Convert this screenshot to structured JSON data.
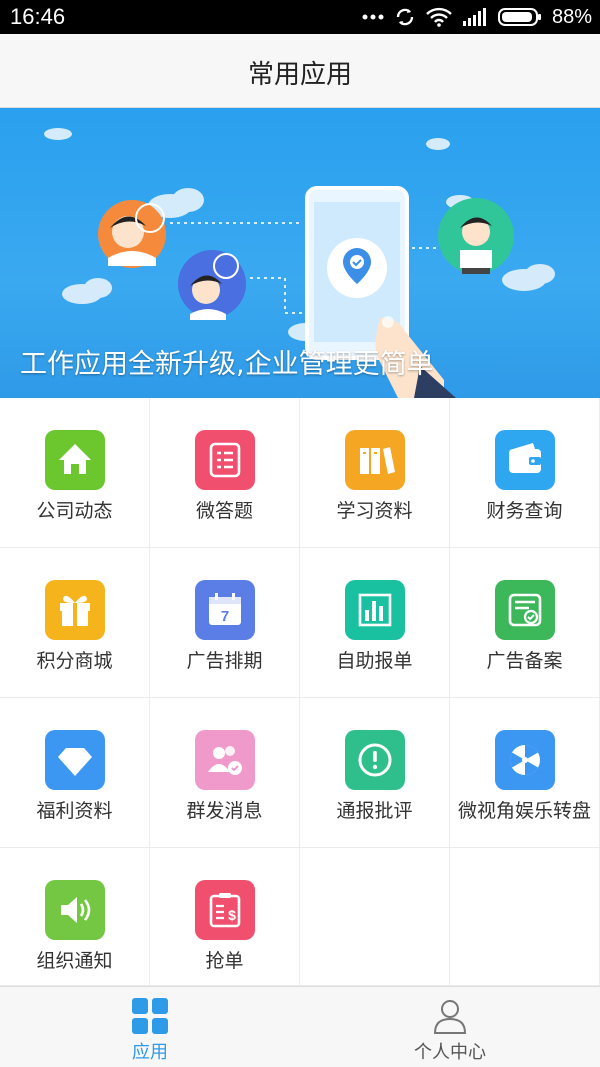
{
  "status_bar": {
    "time": "16:46",
    "battery": "88%"
  },
  "header": {
    "title": "常用应用"
  },
  "banner": {
    "caption": "工作应用全新升级,企业管理更简单"
  },
  "apps": [
    {
      "label": "公司动态",
      "icon": "home-icon",
      "color": "#6cc72e"
    },
    {
      "label": "微答题",
      "icon": "document-list-icon",
      "color": "#f0506e"
    },
    {
      "label": "学习资料",
      "icon": "books-icon",
      "color": "#f5a623"
    },
    {
      "label": "财务查询",
      "icon": "wallet-icon",
      "color": "#2fa6f0"
    },
    {
      "label": "积分商城",
      "icon": "gift-icon",
      "color": "#f5b41b"
    },
    {
      "label": "广告排期",
      "icon": "calendar-icon",
      "color": "#5b7ee6"
    },
    {
      "label": "自助报单",
      "icon": "bar-chart-icon",
      "color": "#19c1a0"
    },
    {
      "label": "广告备案",
      "icon": "certificate-icon",
      "color": "#3cb85a"
    },
    {
      "label": "福利资料",
      "icon": "diamond-icon",
      "color": "#3b97f2"
    },
    {
      "label": "群发消息",
      "icon": "group-users-icon",
      "color": "#f09acb"
    },
    {
      "label": "通报批评",
      "icon": "exclamation-icon",
      "color": "#2fbf8c"
    },
    {
      "label": "微视角娱乐转盘",
      "icon": "turntable-icon",
      "color": "#3b97f2"
    },
    {
      "label": "组织通知",
      "icon": "speaker-icon",
      "color": "#74c743"
    },
    {
      "label": "抢单",
      "icon": "money-clipboard-icon",
      "color": "#f0506e"
    }
  ],
  "tabbar": {
    "tabs": [
      {
        "label": "应用",
        "icon": "apps-grid-icon",
        "active": true
      },
      {
        "label": "个人中心",
        "icon": "person-icon",
        "active": false
      }
    ],
    "active_color": "#2f9ae8"
  }
}
